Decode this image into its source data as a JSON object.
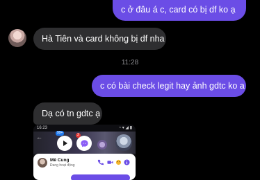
{
  "messages": [
    {
      "id": "b1",
      "direction": "outgoing",
      "text": "c ở đâu á c, card có bị df ko ạ"
    },
    {
      "id": "b2",
      "direction": "incoming",
      "text": "Hà Tiên và card không bị df nha"
    },
    {
      "id": "b3",
      "direction": "outgoing",
      "text": "c có bài check legit hay ảnh gdtc ko a"
    },
    {
      "id": "b4",
      "direction": "incoming",
      "text": "Dạ có tn gdtc ạ"
    }
  ],
  "timestamp": "11:28",
  "screenshot": {
    "status_time": "16:23",
    "status_right": "◔ ▾ ◢ ▮",
    "badge_count": "99+",
    "messenger_badge": "2",
    "contact_name": "Mê Cung",
    "contact_status": "Đang hoạt động"
  },
  "colors": {
    "outgoing_bubble": "#6b4de6",
    "incoming_bubble": "#2e2e30",
    "background": "#000000"
  }
}
